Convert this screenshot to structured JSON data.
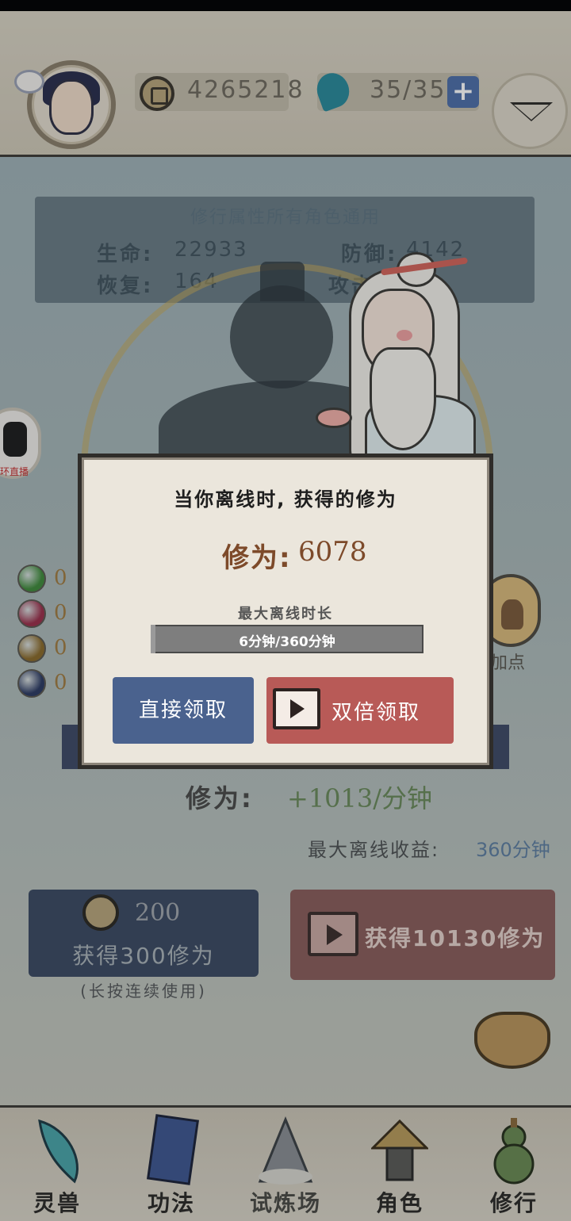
{
  "header": {
    "coin_value": "4265218",
    "energy_value": "35/35",
    "plus_label": "+"
  },
  "attributes": {
    "title": "修行属性所有角色通用",
    "hp_label": "生命:",
    "hp_value": "22933",
    "def_label": "防御:",
    "def_value": "4142",
    "regen_label": "恢复:",
    "regen_value": "164",
    "atk_label": "攻击:"
  },
  "side": {
    "live_text": "环直播",
    "orbs": [
      {
        "color": "#3f8a3a",
        "count": "0"
      },
      {
        "color": "#9a2f4a",
        "count": "0"
      },
      {
        "color": "#8a6a2a",
        "count": "0"
      },
      {
        "color": "#2c3a62",
        "count": "0"
      }
    ],
    "meditate_label": "加点"
  },
  "cultivation": {
    "label": "修为:",
    "rate": "+1013/分钟",
    "offline_label": "最大离线收益:",
    "offline_value": "360分钟"
  },
  "actions": {
    "coin_cost": "200",
    "coin_gain": "获得300修为",
    "hold_hint": "(长按连续使用)",
    "video_gain": "获得10130修为"
  },
  "dialog": {
    "title": "当你离线时, 获得的修为",
    "reward_label": "修为:",
    "reward_value": "6078",
    "max_offline_label": "最大离线时长",
    "progress_text": "6分钟/360分钟",
    "progress_fraction": 0.0167,
    "direct_button": "直接领取",
    "double_button": "双倍领取"
  },
  "nav": {
    "items": [
      {
        "label": "灵兽",
        "icon": "spirit-beast-feather-icon"
      },
      {
        "label": "功法",
        "icon": "skill-book-icon"
      },
      {
        "label": "试炼场",
        "icon": "trial-mountain-icon"
      },
      {
        "label": "角色",
        "icon": "character-hat-icon"
      },
      {
        "label": "修行",
        "icon": "gourd-icon"
      }
    ]
  },
  "colors": {
    "direct_button": "#4a628e",
    "double_button": "#b85a57",
    "reward_text": "#7d4a2a"
  }
}
